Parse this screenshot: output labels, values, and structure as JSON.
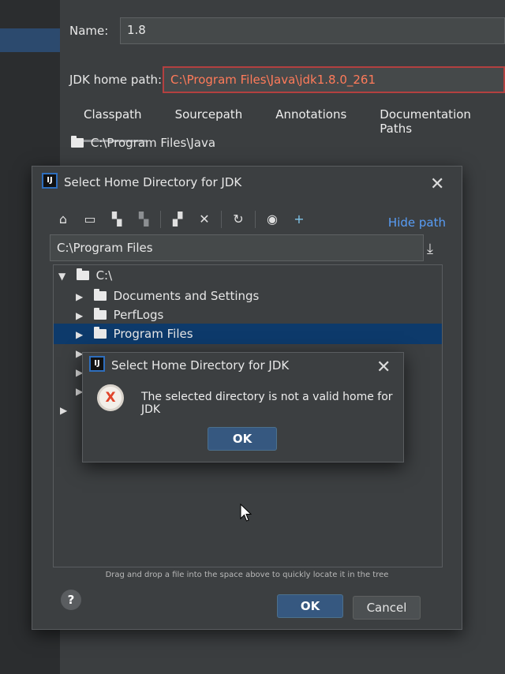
{
  "background": {
    "name_label": "Name:",
    "name_value": "1.8",
    "jdk_label": "JDK home path:",
    "jdk_value": "C:\\Program Files\\Java\\jdk1.8.0_261",
    "tabs": [
      "Classpath",
      "Sourcepath",
      "Annotations",
      "Documentation Paths"
    ],
    "classpath_entry": "C:\\Program Files\\Java"
  },
  "dialog": {
    "title": "Select Home Directory for JDK",
    "hide_path": "Hide path",
    "path_value": "C:\\Program Files",
    "tree": {
      "root": "C:\\",
      "items": [
        "Documents and Settings",
        "PerfLogs",
        "Program Files"
      ]
    },
    "hint": "Drag and drop a file into the space above to quickly locate it in the tree",
    "ok_label": "OK",
    "cancel_label": "Cancel",
    "help_label": "?"
  },
  "popup": {
    "title": "Select Home Directory for JDK",
    "message": "The selected directory is not a valid home for JDK",
    "ok_label": "OK"
  },
  "colors": {
    "accent": "#589df6",
    "selection": "#0d3a6b",
    "error_text": "#ff7b5a"
  }
}
